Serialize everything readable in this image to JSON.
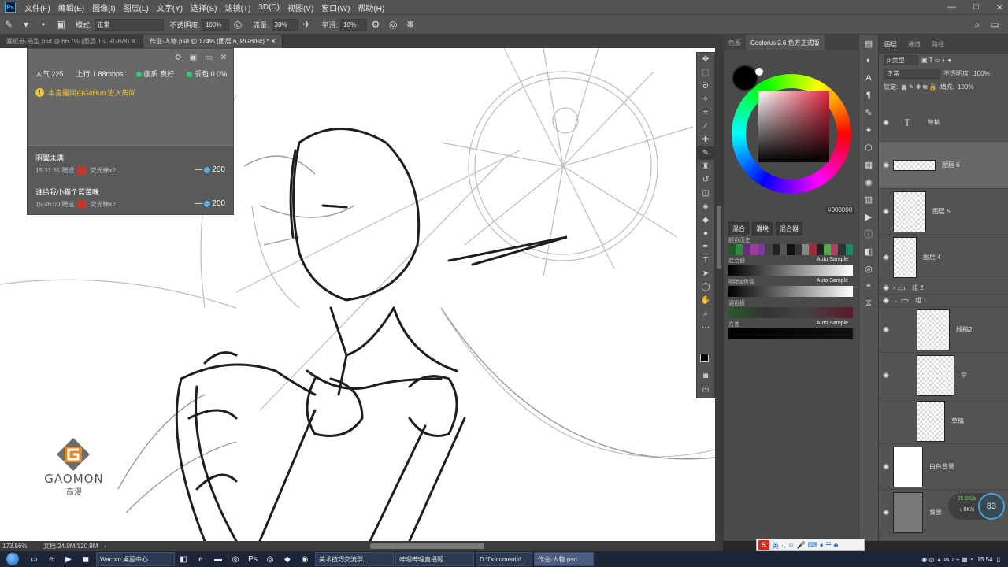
{
  "menubar": {
    "app_logo": "Ps",
    "items": [
      "文件(F)",
      "编辑(E)",
      "图像(I)",
      "图层(L)",
      "文字(Y)",
      "选择(S)",
      "滤镜(T)",
      "3D(D)",
      "视图(V)",
      "窗口(W)",
      "帮助(H)"
    ],
    "window_controls": [
      "—",
      "□",
      "✕"
    ]
  },
  "options": {
    "mode_label": "模式:",
    "mode_value": "正常",
    "opacity_label": "不透明度:",
    "opacity_value": "100%",
    "flow_label": "流量:",
    "flow_value": "38%",
    "smoothing_label": "平滑:",
    "smoothing_value": "10%"
  },
  "tabs": [
    {
      "label": "画纸卷-造型.psd @ 66.7% (图层 15, RGB/8)",
      "active": false
    },
    {
      "label": "作业-人物.psd @ 174% (图层 6, RGB/8#) *",
      "active": true
    }
  ],
  "overlay": {
    "viewers": "人气 225",
    "bitrate": "上行 1.88mbps",
    "quality": "画质 良好",
    "packet_loss": "丢包 0.0%",
    "notice": "本直播间由GitHub 进入房间",
    "messages": [
      {
        "name": "羽翼未满",
        "time": "15:31:31 赠送",
        "gift": "荧光棒x2",
        "amount": "200"
      },
      {
        "name": "谁给我小猫个蓝莓味",
        "time": "15:46:00 赠送",
        "gift": "荧光棒x2",
        "amount": "200"
      }
    ]
  },
  "watermark": {
    "brand": "GAOMON",
    "sub": "高漫",
    "brand_color": "#e08a2a"
  },
  "status": {
    "zoom": "173.56%",
    "doc": "文档:24.9M/120.9M"
  },
  "colorus": {
    "tabs": [
      "色板",
      "Coolorus 2.6 色方正式版"
    ],
    "hex": "#000000",
    "subtabs": [
      "混合",
      "滑块",
      "混合器"
    ],
    "history_label": "颜色历史",
    "mixer_label": "混合器",
    "gradient1_label": "明暗&色调",
    "gradient2_label": "调色板",
    "gradient3_label": "方差",
    "auto_sample": "Auto Sample",
    "accent_red": "#e0243d",
    "history_colors": [
      "#1f5d28",
      "#2e8b3c",
      "#6a2c7a",
      "#a33b9c",
      "#7a3aa0",
      "#444",
      "#222",
      "#555",
      "#111",
      "#333",
      "#888",
      "#9e2a3a",
      "#222",
      "#5aa85a",
      "#b04060",
      "#333",
      "#1b8a6b"
    ]
  },
  "layers": {
    "tabs": [
      "图层",
      "通道",
      "路径"
    ],
    "filter_label": "ρ 类型",
    "blend_mode": "正常",
    "opacity_label": "不透明度:",
    "opacity_value": "100%",
    "lock_label": "锁定:",
    "fill_label": "填充:",
    "fill_value": "100%",
    "items": [
      {
        "name": "草稿",
        "kind": "text",
        "visible": true,
        "selected": false
      },
      {
        "name": "图层 6",
        "kind": "pixel",
        "visible": true,
        "selected": true
      },
      {
        "name": "图层 5",
        "kind": "pixel",
        "visible": true,
        "selected": false
      },
      {
        "name": "图层 4",
        "kind": "pixel",
        "visible": true,
        "selected": false
      },
      {
        "name": "组 2",
        "kind": "group",
        "visible": true,
        "selected": false
      },
      {
        "name": "组 1",
        "kind": "group-open",
        "visible": true,
        "selected": false
      },
      {
        "name": "线稿2",
        "kind": "pixel",
        "visible": true,
        "selected": false
      },
      {
        "name": "伞",
        "kind": "pixel",
        "visible": true,
        "selected": false
      },
      {
        "name": "草稿",
        "kind": "pixel",
        "visible": false,
        "selected": false
      },
      {
        "name": "白色背景",
        "kind": "white",
        "visible": true,
        "selected": false
      },
      {
        "name": "背景",
        "kind": "gray",
        "visible": true,
        "selected": false
      }
    ]
  },
  "netwidget": {
    "percent": "83",
    "up": "↑ 25.9K/s",
    "down": "↓ 0K/s"
  },
  "ime": {
    "logo": "S",
    "mode": "英"
  },
  "taskbar": {
    "buttons": [
      {
        "label": "Wacom 桌面中心",
        "active": false
      },
      {
        "label": "美术技巧交流群...",
        "active": false
      },
      {
        "label": "哔哩哔哩直播姬",
        "active": false
      },
      {
        "label": "D:\\Documents\\...",
        "active": false
      },
      {
        "label": "作业-人物.psd ...",
        "active": true
      }
    ],
    "clock": "15:54"
  }
}
